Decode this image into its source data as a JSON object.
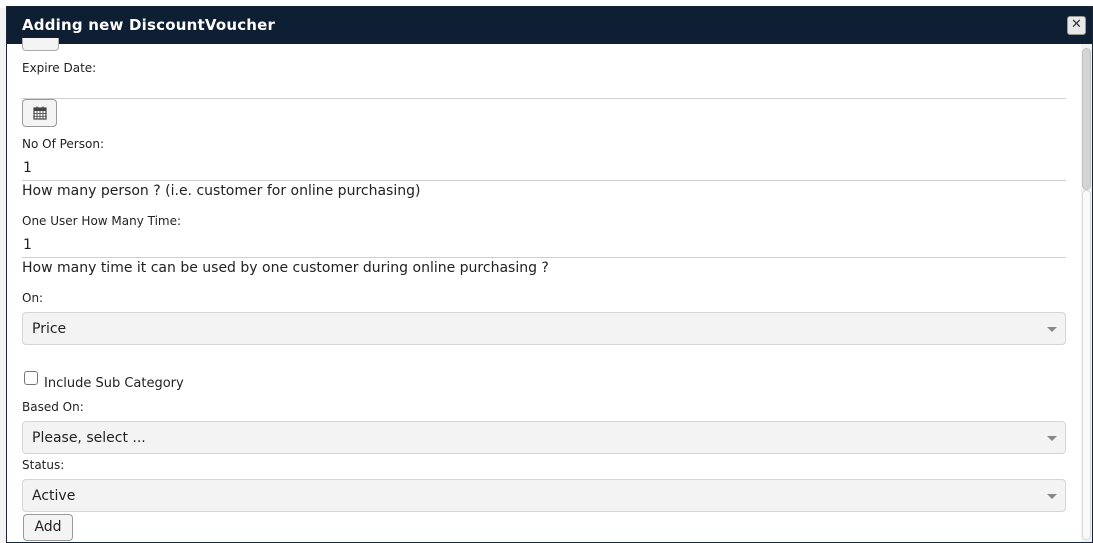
{
  "dialog": {
    "title": "Adding new DiscountVoucher",
    "close_icon": "close-icon"
  },
  "form": {
    "expire_date": {
      "label": "Expire Date:",
      "value": "",
      "calendar_icon": "calendar-icon"
    },
    "no_of_person": {
      "label": "No Of Person:",
      "value": "1",
      "help": "How many person ? (i.e. customer for online purchasing)"
    },
    "one_user_how_many_time": {
      "label": "One User How Many Time:",
      "value": "1",
      "help": "How many time it can be used by one customer during online purchasing ?"
    },
    "on": {
      "label": "On:",
      "selected": "Price"
    },
    "include_sub_category": {
      "label": "Include Sub Category",
      "checked": false
    },
    "based_on": {
      "label": "Based On:",
      "selected": "Please, select ..."
    },
    "status": {
      "label": "Status:",
      "selected": "Active"
    },
    "submit_label": "Add"
  },
  "colors": {
    "titlebar": "#0f1f33",
    "title_text": "#ffffff",
    "select_bg": "#f3f3f3"
  }
}
